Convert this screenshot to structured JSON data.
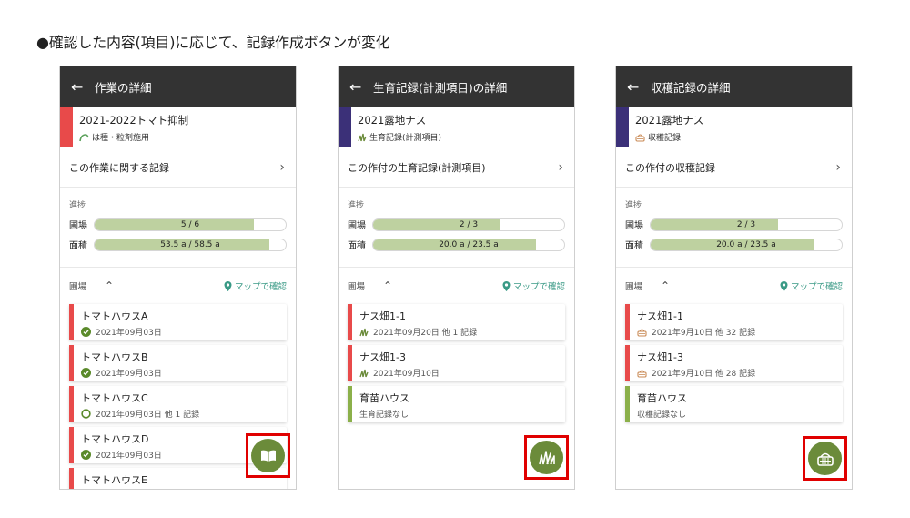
{
  "slide_title": "●確認した内容(項目)に応じて、記録作成ボタンが変化",
  "colors": {
    "appbar": "#333333",
    "red": "#e84a4a",
    "purple": "#3b3078",
    "green": "#8bb04a",
    "fab": "#6b8b3a",
    "highlight": "#e00000"
  },
  "screens": [
    {
      "header": {
        "back_icon": "arrow-left",
        "title": "作業の詳細"
      },
      "crop": {
        "name": "2021-2022トマト抑制",
        "sub_icon": "seeding-icon",
        "sub": "は種・粒剤施用"
      },
      "records_link": {
        "label": "この作業に関する記録",
        "chevron": "›"
      },
      "progress": {
        "label": "進捗",
        "fields": {
          "label": "圃場",
          "text": "5 / 6",
          "fraction": 0.833
        },
        "area": {
          "label": "面積",
          "text": "53.5 a / 58.5 a",
          "fraction": 0.915
        }
      },
      "fields_header": {
        "label": "圃場",
        "toggle": "⌃",
        "map_label": "マップで確認"
      },
      "fields": [
        {
          "name": "トマトハウスA",
          "status": "done",
          "sub": "2021年09月03日"
        },
        {
          "name": "トマトハウスB",
          "status": "done",
          "sub": "2021年09月03日"
        },
        {
          "name": "トマトハウスC",
          "status": "partial",
          "sub": "2021年09月03日 他 1 記録"
        },
        {
          "name": "トマトハウスD",
          "status": "done",
          "sub": "2021年09月03日"
        },
        {
          "name": "トマトハウスE",
          "status": "done",
          "sub": ""
        }
      ],
      "fab_icon": "book-icon"
    },
    {
      "header": {
        "back_icon": "arrow-left",
        "title": "生育記録(計測項目)の詳細"
      },
      "crop": {
        "name": "2021露地ナス",
        "sub_icon": "growth-icon",
        "sub": "生育記録(計測項目)"
      },
      "records_link": {
        "label": "この作付の生育記録(計測項目)",
        "chevron": "›"
      },
      "progress": {
        "label": "進捗",
        "fields": {
          "label": "圃場",
          "text": "2 / 3",
          "fraction": 0.667
        },
        "area": {
          "label": "面積",
          "text": "20.0 a / 23.5 a",
          "fraction": 0.851
        }
      },
      "fields_header": {
        "label": "圃場",
        "toggle": "⌃",
        "map_label": "マップで確認"
      },
      "fields": [
        {
          "name": "ナス畑1-1",
          "status": "growth",
          "sub": "2021年09月20日 他 1 記録"
        },
        {
          "name": "ナス畑1-3",
          "status": "growth",
          "sub": "2021年09月10日"
        },
        {
          "name": "育苗ハウス",
          "status": "none",
          "sub": "生育記録なし"
        }
      ],
      "fab_icon": "grass-icon"
    },
    {
      "header": {
        "back_icon": "arrow-left",
        "title": "収穫記録の詳細"
      },
      "crop": {
        "name": "2021露地ナス",
        "sub_icon": "basket-icon",
        "sub": "収穫記録"
      },
      "records_link": {
        "label": "この作付の収穫記録",
        "chevron": "›"
      },
      "progress": {
        "label": "進捗",
        "fields": {
          "label": "圃場",
          "text": "2 / 3",
          "fraction": 0.667
        },
        "area": {
          "label": "面積",
          "text": "20.0 a / 23.5 a",
          "fraction": 0.851
        }
      },
      "fields_header": {
        "label": "圃場",
        "toggle": "⌃",
        "map_label": "マップで確認"
      },
      "fields": [
        {
          "name": "ナス畑1-1",
          "status": "harvest",
          "sub": "2021年9月10日 他 32 記録"
        },
        {
          "name": "ナス畑1-3",
          "status": "harvest",
          "sub": "2021年9月10日 他 28 記録"
        },
        {
          "name": "育苗ハウス",
          "status": "none",
          "sub": "収穫記録なし"
        }
      ],
      "fab_icon": "basket-icon"
    }
  ]
}
